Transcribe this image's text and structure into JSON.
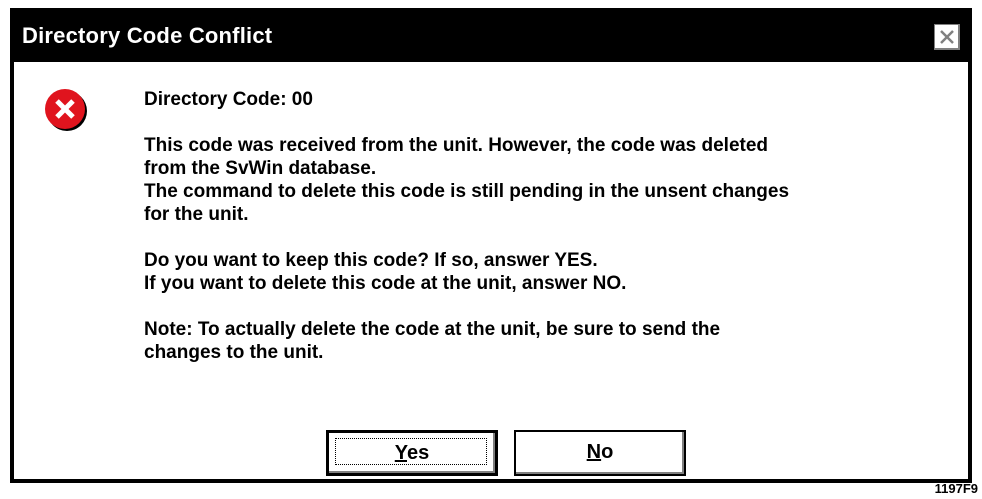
{
  "dialog": {
    "title": "Directory Code Conflict",
    "close_icon": "close-x-icon",
    "message_icon": "error-icon",
    "message_icon_color": "#e0141e",
    "lines": {
      "code": "Directory Code:  00",
      "p1_l1": "This code was received from the unit. However, the code was deleted",
      "p1_l2": "from the SvWin database.",
      "p1_l3": "The command to delete this code is still pending in the unsent changes",
      "p1_l4": "for the unit.",
      "p2_l1": "Do you want to keep this code?  If so, answer YES.",
      "p2_l2": "If you want to delete this code at the unit, answer NO.",
      "p3_l1": "Note:  To actually delete the code at the unit, be sure to send the",
      "p3_l2": "changes to the unit."
    },
    "buttons": {
      "yes_mnemonic": "Y",
      "yes_rest": "es",
      "no_mnemonic": "N",
      "no_rest": "o"
    }
  },
  "figure_code": "1197F9"
}
